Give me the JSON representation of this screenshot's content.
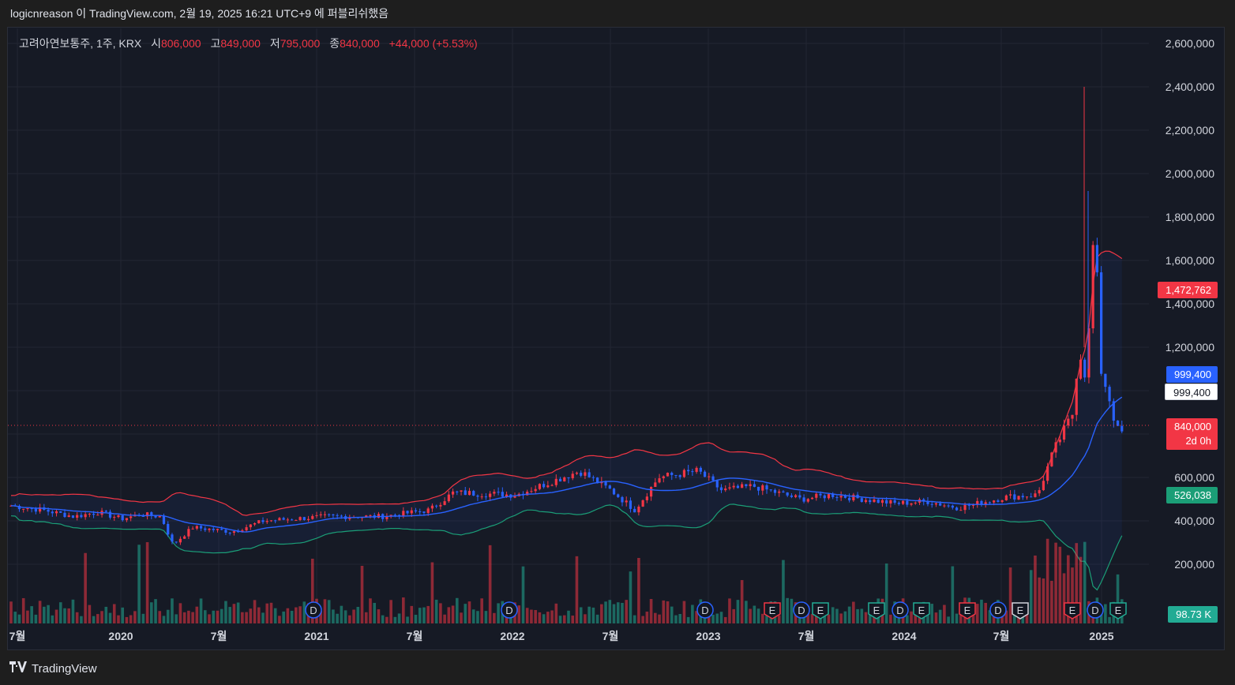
{
  "header": {
    "publish_text": "logicnreason 이 TradingView.com, 2월 19, 2025 16:21 UTC+9 에 퍼블리쉬했음"
  },
  "legend": {
    "symbol": "고려아연보통주, 1주, KRX",
    "open_label": "시",
    "open_value": "806,000",
    "high_label": "고",
    "high_value": "849,000",
    "low_label": "저",
    "low_value": "795,000",
    "close_label": "종",
    "close_value": "840,000",
    "change": "+44,000 (+5.53%)"
  },
  "price_tags": {
    "upper_band": "1,472,762",
    "basis": "999,400",
    "basis_secondary": "999,400",
    "last_price": "840,000",
    "countdown": "2d 0h",
    "lower_band": "526,038",
    "volume": "98.73 K"
  },
  "footer": {
    "brand": "TradingView",
    "logo_icon": "tradingview-logo-icon"
  },
  "colors": {
    "up": "#f23645",
    "down": "#2962ff",
    "vol_up": "#f23645",
    "vol_down": "#22ab94",
    "upper_band": "#f23645",
    "basis": "#2962ff",
    "lower_band": "#1b9e77",
    "grid": "#232632",
    "text": "#d1d4dc"
  },
  "chart_data": {
    "type": "candlestick",
    "interval": "1 week",
    "price_axis_labels": [
      "2,600,000",
      "2,400,000",
      "2,200,000",
      "2,000,000",
      "1,800,000",
      "1,600,000",
      "1,400,000",
      "1,200,000",
      "1,000,000",
      "600,000",
      "400,000",
      "200,000"
    ],
    "price_axis_ticks": [
      2600000,
      2400000,
      2200000,
      2000000,
      1800000,
      1600000,
      1400000,
      1200000,
      1000000,
      600000,
      400000,
      200000
    ],
    "time_axis_labels": [
      "7월",
      "2020",
      "7월",
      "2021",
      "7월",
      "2022",
      "7월",
      "2023",
      "7월",
      "2024",
      "7월",
      "2025"
    ],
    "ylim": [
      0,
      2650000
    ],
    "indicators": [
      "Bollinger Bands",
      "Volume"
    ],
    "event_markers": [
      {
        "type": "D"
      },
      {
        "type": "D"
      },
      {
        "type": "D"
      },
      {
        "type": "E"
      },
      {
        "type": "D"
      },
      {
        "type": "E"
      },
      {
        "type": "E"
      },
      {
        "type": "D"
      },
      {
        "type": "E"
      },
      {
        "type": "E"
      },
      {
        "type": "D"
      },
      {
        "type": "E"
      },
      {
        "type": "E"
      },
      {
        "type": "D"
      },
      {
        "type": "E"
      }
    ],
    "key_points": {
      "last_close": 840000,
      "all_time_high_wick": 2400000,
      "upper_band": 1472762,
      "basis": 999400,
      "lower_band": 526038,
      "last_volume": "98.73 K"
    }
  }
}
